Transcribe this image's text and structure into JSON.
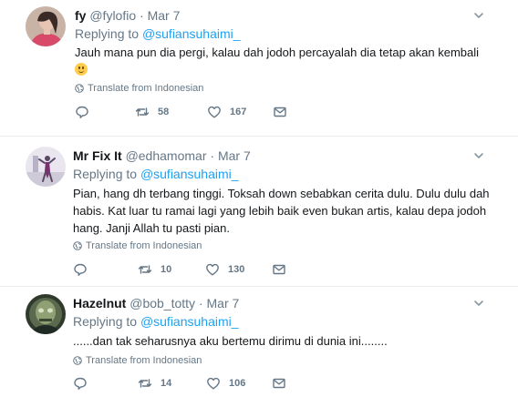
{
  "tweets": [
    {
      "name": "fy",
      "handle": "@fylofio",
      "dot": "·",
      "date": "Mar 7",
      "replying_prefix": "Replying to",
      "replying_to": "@sufiansuhaimi_",
      "text": "Jauh mana pun dia pergi, kalau dah jodoh percayalah dia tetap akan kembali",
      "emoji": "upside-down-face",
      "translate": "Translate from Indonesian",
      "replies": "",
      "retweets": "58",
      "likes": "167"
    },
    {
      "name": "Mr Fix It",
      "handle": "@edhamomar",
      "dot": "·",
      "date": "Mar 7",
      "replying_prefix": "Replying to",
      "replying_to": "@sufiansuhaimi_",
      "text_lines": [
        "Pian, hang dh terbang tinggi. Toksah down sebabkan cerita dulu. Dulu dulu dah",
        "habis. Kat luar tu ramai lagi yang lebih baik even bukan artis, kalau depa jodoh",
        "hang. Janji Allah tu pasti pian."
      ],
      "translate": "Translate from Indonesian",
      "replies": "",
      "retweets": "10",
      "likes": "130"
    },
    {
      "name": "Hazelnut",
      "handle": "@bob_totty",
      "dot": "·",
      "date": "Mar 7",
      "replying_prefix": "Replying to",
      "replying_to": "@sufiansuhaimi_",
      "text": "......dan tak seharusnya aku bertemu dirimu di dunia ini........",
      "translate": "Translate from Indonesian",
      "replies": "",
      "retweets": "14",
      "likes": "106"
    }
  ],
  "colors": {
    "link": "#1da1f2",
    "muted": "#657786",
    "text": "#14171a",
    "divider": "#e6ecf0"
  },
  "icons": {
    "reply": "reply-icon",
    "retweet": "retweet-icon",
    "like": "heart-icon",
    "dm": "envelope-icon",
    "translate": "globe-icon",
    "more": "chevron-down-icon"
  }
}
